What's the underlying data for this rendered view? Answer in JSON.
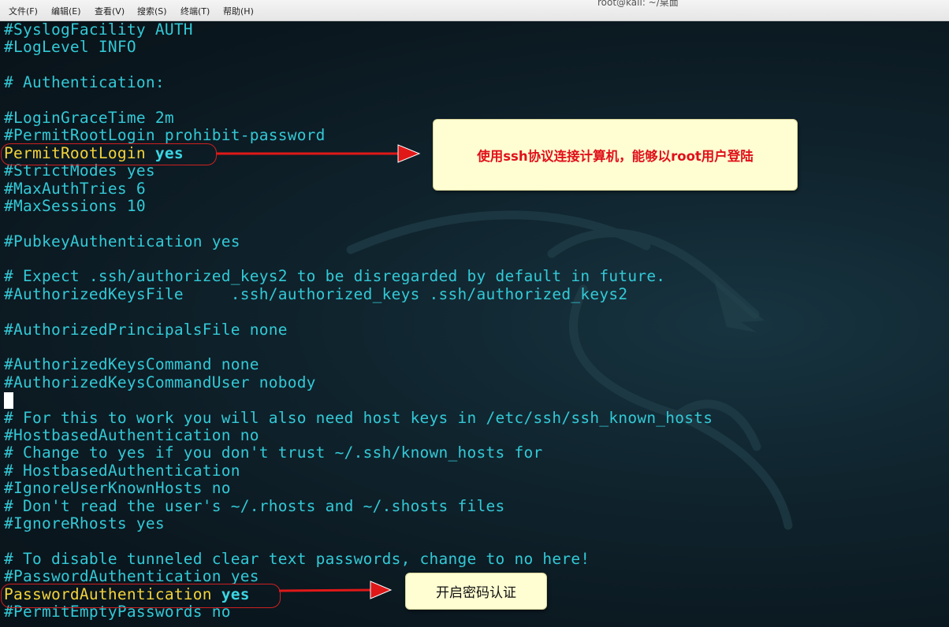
{
  "window": {
    "title": "root@kali: ~/桌面"
  },
  "menu": [
    {
      "label": "文件(F)"
    },
    {
      "label": "编辑(E)"
    },
    {
      "label": "查看(V)"
    },
    {
      "label": "搜索(S)"
    },
    {
      "label": "终端(T)"
    },
    {
      "label": "帮助(H)"
    }
  ],
  "lines": [
    {
      "text": "#SyslogFacility AUTH"
    },
    {
      "text": "#LogLevel INFO"
    },
    {
      "text": ""
    },
    {
      "text": "# Authentication:"
    },
    {
      "text": ""
    },
    {
      "text": "#LoginGraceTime 2m"
    },
    {
      "text": "#PermitRootLogin prohibit-password"
    },
    {
      "key": "PermitRootLogin",
      "value": "yes"
    },
    {
      "text": "#StrictModes yes"
    },
    {
      "text": "#MaxAuthTries 6"
    },
    {
      "text": "#MaxSessions 10"
    },
    {
      "text": ""
    },
    {
      "text": "#PubkeyAuthentication yes"
    },
    {
      "text": ""
    },
    {
      "text": "# Expect .ssh/authorized_keys2 to be disregarded by default in future."
    },
    {
      "text": "#AuthorizedKeysFile     .ssh/authorized_keys .ssh/authorized_keys2"
    },
    {
      "text": ""
    },
    {
      "text": "#AuthorizedPrincipalsFile none"
    },
    {
      "text": ""
    },
    {
      "text": "#AuthorizedKeysCommand none"
    },
    {
      "text": "#AuthorizedKeysCommandUser nobody"
    },
    {
      "cursor": true
    },
    {
      "text": "# For this to work you will also need host keys in /etc/ssh/ssh_known_hosts"
    },
    {
      "text": "#HostbasedAuthentication no"
    },
    {
      "text": "# Change to yes if you don't trust ~/.ssh/known_hosts for"
    },
    {
      "text": "# HostbasedAuthentication"
    },
    {
      "text": "#IgnoreUserKnownHosts no"
    },
    {
      "text": "# Don't read the user's ~/.rhosts and ~/.shosts files"
    },
    {
      "text": "#IgnoreRhosts yes"
    },
    {
      "text": ""
    },
    {
      "text": "# To disable tunneled clear text passwords, change to no here!"
    },
    {
      "text": "#PasswordAuthentication yes"
    },
    {
      "key": "PasswordAuthentication",
      "value": "yes"
    },
    {
      "text": "#PermitEmptyPasswords no"
    }
  ],
  "callouts": {
    "root_login": {
      "parts": [
        "使用",
        "ssh",
        "协议连接计算机，能够以",
        "root",
        "用户登陆"
      ]
    },
    "password": {
      "text": "开启密码认证"
    }
  },
  "colors": {
    "terminal_text": "#33c9d6",
    "active_key": "#f3d33a",
    "highlight_border": "#d02020",
    "callout_bg": "#fffdd2",
    "arrow": "#e01818"
  }
}
